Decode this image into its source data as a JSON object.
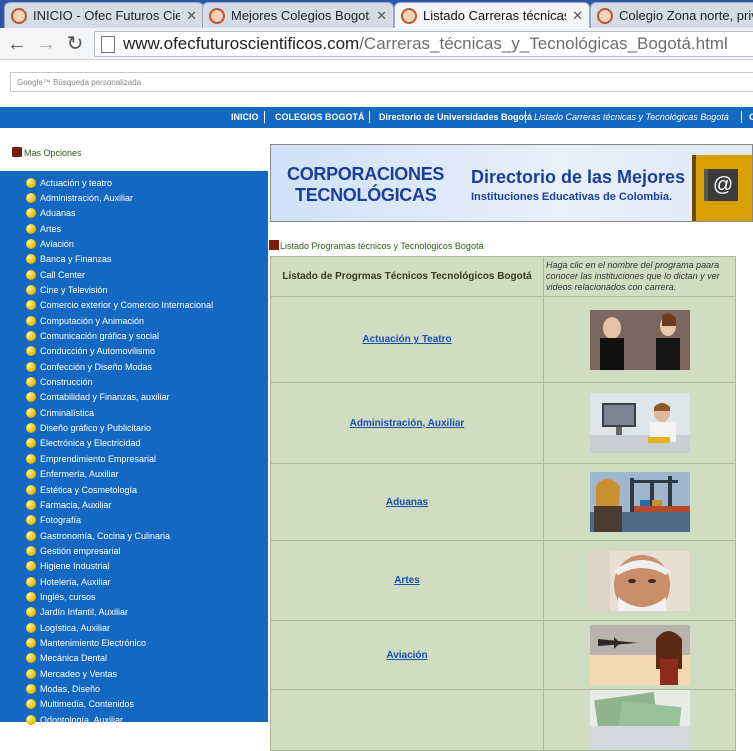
{
  "browser": {
    "tabs": [
      {
        "title": "INICIO - Ofec Futuros Cien",
        "close": "✕",
        "active": false
      },
      {
        "title": "Mejores Colegios Bogotá",
        "close": "✕",
        "active": false
      },
      {
        "title": "Listado Carreras técnicas y",
        "close": "✕",
        "active": true
      },
      {
        "title": "Colegio Zona norte, priva",
        "close": "",
        "active": false
      }
    ],
    "back_icon": "←",
    "forward_icon": "→",
    "reload_icon": "↻",
    "url_host": "www.ofecfuturoscientificos.com",
    "url_path": "/Carreras_técnicas_y_Tecnológicas_Bogotá.html"
  },
  "google_search": {
    "placeholder": "Google™ Búsqueda personalizada"
  },
  "topnav": [
    "INICIO",
    "COLEGIOS BOGOTÁ",
    "Directorio de Universidades Bogotá",
    "Listado Carreras técnicas y Tecnológicas Bogotá",
    "C"
  ],
  "sidebar": {
    "title": "Mas Opciones",
    "items": [
      "Actuación y teatro",
      "Administración, Auxiliar",
      "Aduanas",
      "Artes",
      "Aviación",
      "Banca y Finanzas",
      "Call Center",
      "Cine y Televisión",
      "Comercio exterior y Comercio Internacional",
      "Computación y Animación",
      "Comunicación gráfica y social",
      "Conducción y Automovilismo",
      "Confección y Diseño Modas",
      "Construcción",
      "Contabilidad y Finanzas, auxiliar",
      "Criminalística",
      "Diseño gráfico y Publicitario",
      "Electrónica y Electricidad",
      "Emprendimiento Empresarial",
      "Enfermería, Auxiliar",
      "Estética y Cosmetología",
      "Farmacia, Auxiliar",
      "Fotografía",
      "Gastronomía, Cocina y Culinaria",
      "Gestión empresarial",
      "Higiene Industrial",
      "Hotelería, Auxiliar",
      "Inglés, cursos",
      "Jardín Infantil, Auxiliar",
      "Logística, Auxiliar",
      "Mantenimiento Electrónico",
      "Mecánica Dental",
      "Mercadeo y Ventas",
      "Modas, Diseño",
      "Multimedia, Contenidos",
      "Odontología, Auxiliar"
    ]
  },
  "banner": {
    "left_line1": "CORPORACIONES",
    "left_line2": "TECNOLÓGICAS",
    "right_line1": "Directorio de las Mejores",
    "right_line2": "Instituciones Educativas de Colombia.",
    "icon_char": "@"
  },
  "content": {
    "breadcrumb": "Listado Programas técnicos y Tecnológicos Bogotá",
    "table_header": "Listado de Progrmas  Técnicos Tecnológicos  Bogotá",
    "table_hint": "Haga clic en el nombre del programa paara conocer las instituciones que lo dictan y ver videos relacionados con carrera.",
    "rows": [
      {
        "program": "Actuación y Teatro",
        "image": "actors-photo"
      },
      {
        "program": "Administración, Auxiliar",
        "image": "office-worker-photo"
      },
      {
        "program": "Aduanas",
        "image": "port-cranes-photo"
      },
      {
        "program": "Artes",
        "image": "elderly-man-portrait"
      },
      {
        "program": "Aviación",
        "image": "airplane-woman-photo"
      },
      {
        "program": "",
        "image": "money-photo"
      }
    ]
  },
  "colors": {
    "blue": "#1468c1",
    "table_bg": "#d0ddc1",
    "link": "#1a4fb0"
  }
}
